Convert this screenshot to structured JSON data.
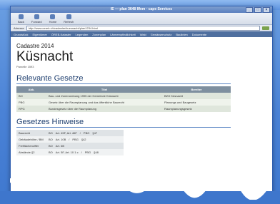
{
  "window": {
    "title": "IE — plan 3648 IIfem · cape Services",
    "controls": [
      "_",
      "□",
      "×"
    ]
  },
  "toolbar": {
    "buttons": [
      {
        "label": "Back",
        "icon": "back-arrow-icon"
      },
      {
        "label": "Forward",
        "icon": "forward-arrow-icon"
      },
      {
        "label": "Home",
        "icon": "home-icon"
      },
      {
        "label": "Refresh",
        "icon": "refresh-icon"
      }
    ]
  },
  "address": {
    "label": "Adresse",
    "value": "http://www.oereb.ch/cadastre/kuesnacht/plan1234.html"
  },
  "navbar": {
    "items": [
      "Grundstück",
      "Eigentümer",
      "ÖREB-Kataster",
      "Legenden",
      "Zonenplan",
      "Lärmempfindlichkeit",
      "Wald",
      "Gewässerschutz",
      "Baulinien",
      "Dokumente"
    ]
  },
  "page": {
    "cadastre": "Cadastre 2014",
    "title": "Küsnacht",
    "subline": "Parzelle 1593",
    "section1": "Relevante Gesetze",
    "section2": "Gesetzes Hinweise"
  },
  "laws_table": {
    "headers": [
      "Abk.",
      "Titel",
      "Bereiter"
    ],
    "rows": [
      [
        "BO",
        "Bau- und Zonenordnung 1995 der Gemeinde Küsnacht",
        "BZO Küsnacht"
      ],
      [
        "PBG",
        "Gesetz über die Raumplanung und das öffentliche Baurecht",
        "Planungs und Baugesetz"
      ],
      [
        "RPG",
        "Bundesgesetz über die Raumplanung",
        "Raumplanungsgesetz"
      ]
    ]
  },
  "hinweise": {
    "rows": [
      [
        "Baurecht",
        "BO",
        "Art. 45F, Art. 46F",
        "/",
        "PBG",
        "§47"
      ],
      [
        "Gebäudehöhe / BM",
        "BO",
        "Art. 10B",
        "/",
        "PBG",
        "§42"
      ],
      [
        "Freiflächenziffer",
        "BO",
        "Art. 6B",
        "",
        "",
        ""
      ],
      [
        "Abstände §2",
        "BO",
        "Art. 5F, Art. 10 1 c",
        "/",
        "PBG",
        "§48"
      ]
    ]
  },
  "colors": {
    "background": "#4a82d6",
    "nav": "#4f6f9f",
    "header": "#7e8f9f",
    "section": "#1f3f6f"
  }
}
